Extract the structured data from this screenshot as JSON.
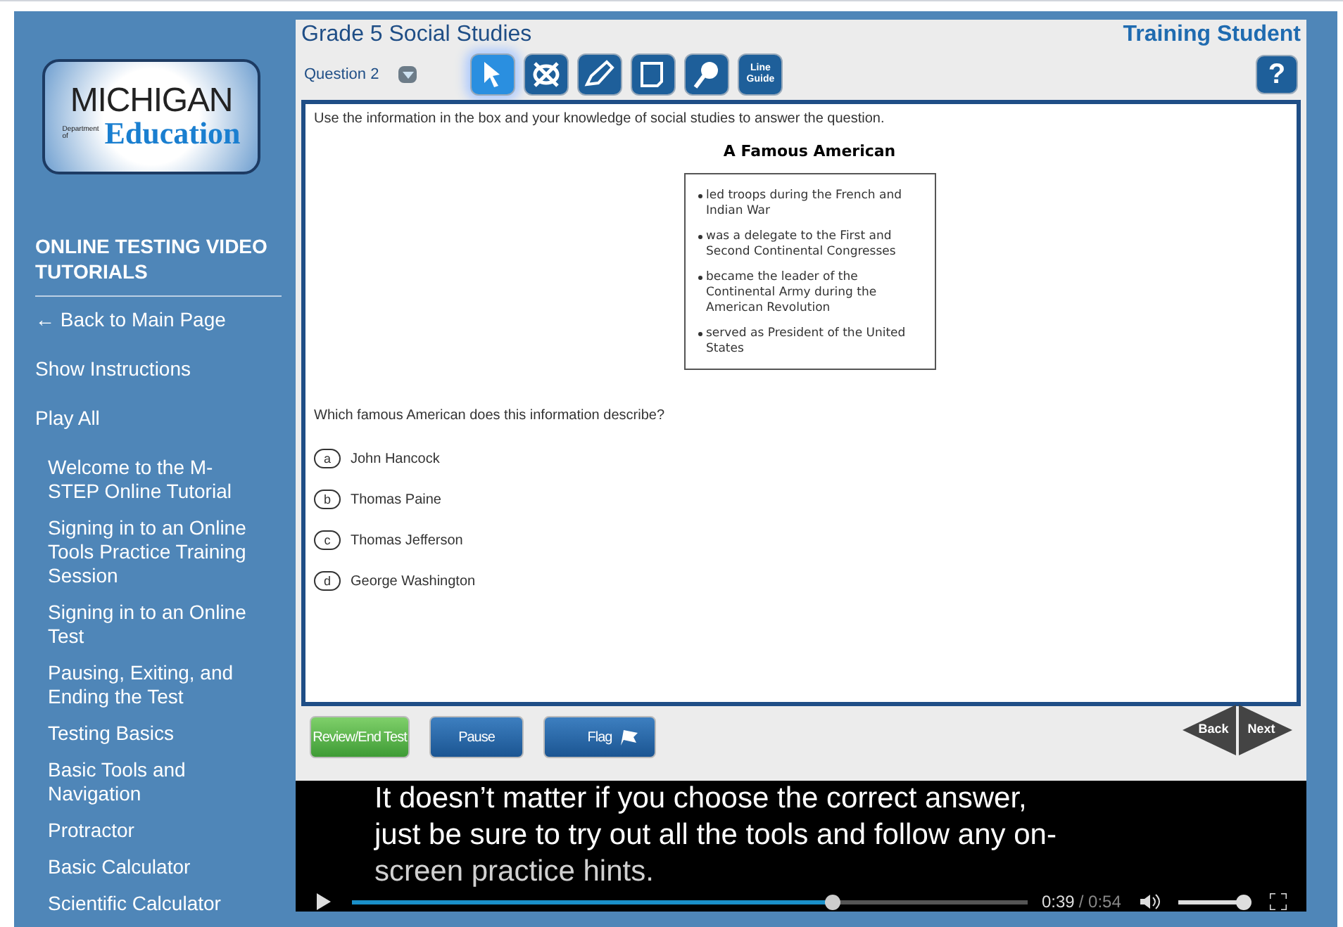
{
  "sidebar": {
    "logo": {
      "word_top": "MICHIGAN",
      "small": "Department of",
      "word_bottom": "Education"
    },
    "heading": "ONLINE TESTING VIDEO TUTORIALS",
    "links": [
      "← Back to Main Page",
      "Show Instructions",
      "Play All"
    ],
    "tutorials": [
      "Welcome to the M-STEP Online Tutorial",
      "Signing in to an Online Tools Practice Training Session",
      "Signing in to an Online Test",
      "Pausing, Exiting, and Ending the Test",
      "Testing Basics",
      "Basic Tools and Navigation",
      "Protractor",
      "Basic Calculator",
      "Scientific Calculator"
    ]
  },
  "test": {
    "title": "Grade 5 Social Studies",
    "student": "Training Student",
    "question_label": "Question 2",
    "tools": [
      {
        "kind": "pointer",
        "selected": true
      },
      {
        "kind": "eliminator",
        "selected": false
      },
      {
        "kind": "highlighter",
        "selected": false
      },
      {
        "kind": "notepad",
        "selected": false
      },
      {
        "kind": "zoom",
        "selected": false
      },
      {
        "kind": "line-guide",
        "label": "Line Guide",
        "selected": false
      }
    ],
    "help": "?",
    "instruction": "Use the information in the box and your knowledge of social studies to answer the question.",
    "box_title": "A Famous American",
    "box_items": [
      "led troops during the French and Indian War",
      "was a delegate to the First and Second Continental Congresses",
      "became the leader of the Continental Army during the American Revolution",
      "served as President of the United States"
    ],
    "question": "Which famous American does this information describe?",
    "options": [
      {
        "letter": "a",
        "text": "John Hancock"
      },
      {
        "letter": "b",
        "text": "Thomas Paine"
      },
      {
        "letter": "c",
        "text": "Thomas Jefferson"
      },
      {
        "letter": "d",
        "text": "George Washington"
      }
    ],
    "buttons": [
      {
        "kind": "review",
        "label": "Review/End Test"
      },
      {
        "kind": "pause",
        "label": "Pause"
      },
      {
        "kind": "flag",
        "label": "Flag"
      }
    ],
    "nav": [
      "Back",
      "Next"
    ]
  },
  "video": {
    "captions": [
      "It doesn’t matter if you choose the correct answer,",
      "just be sure to try out all the tools and follow any on-",
      "screen practice hints."
    ],
    "progress": {
      "level": 0.71
    },
    "time": "0:39",
    "duration": "/ 0:54",
    "volume": {
      "level": 1
    }
  }
}
